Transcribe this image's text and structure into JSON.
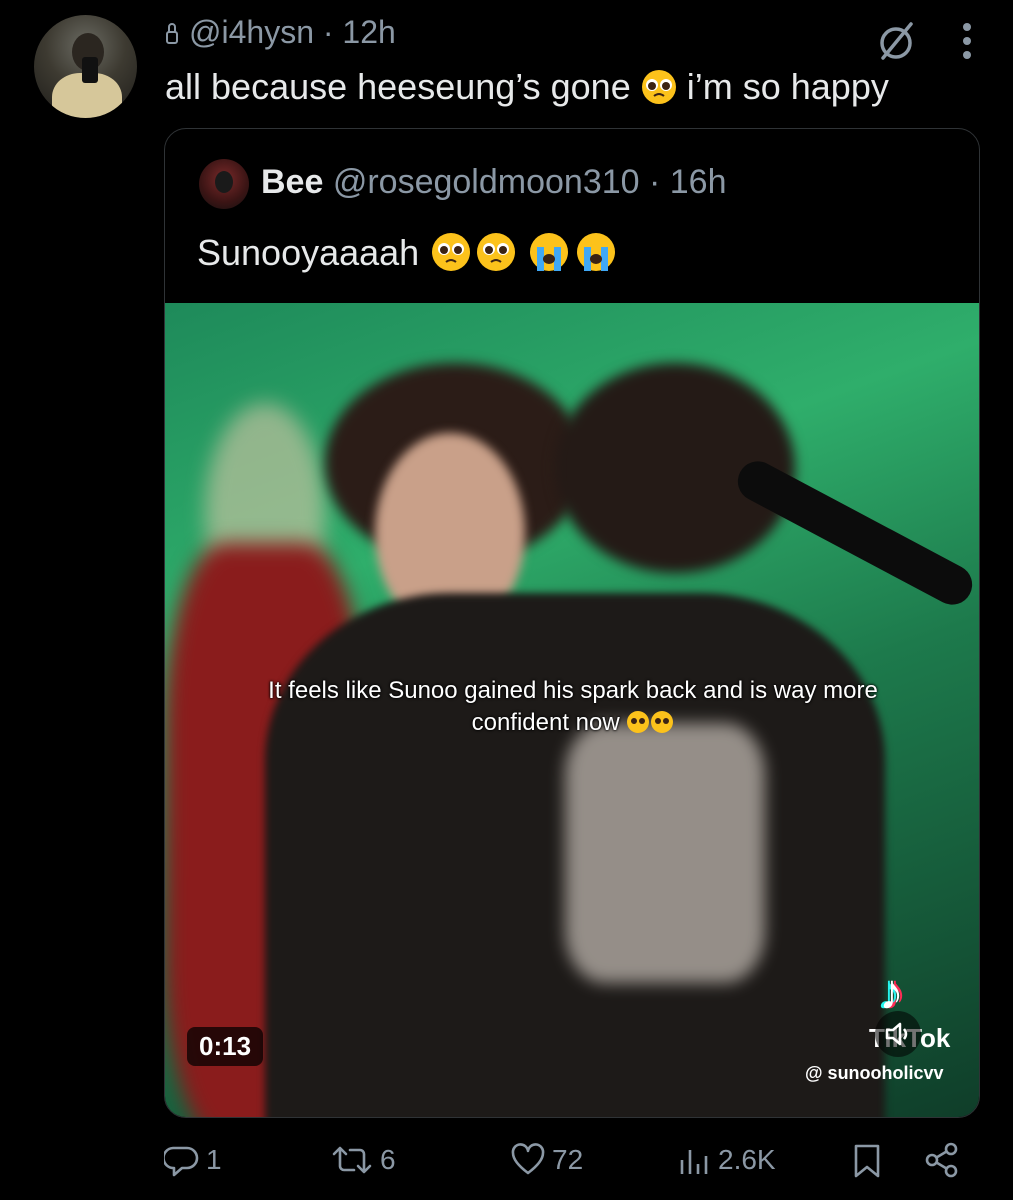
{
  "tweet": {
    "handle_meta": "@i4hysn · 12h",
    "text": "all because heeseung’s gone",
    "text_after_emoji": "i’m so happy"
  },
  "quote": {
    "name": "Bee",
    "meta": "@rosegoldmoon310 · 16h",
    "text": "Sunooyaaaah"
  },
  "media": {
    "caption_line1": "It feels like Sunoo gained his spark back and is way more",
    "caption_line2": "confident now",
    "tiktok_label": "TikTok",
    "tiktok_handle": "@ sunooholicvv",
    "duration": "0:13"
  },
  "actions": {
    "reply_count": "1",
    "repost_count": "6",
    "like_count": "72",
    "view_count": "2.6K"
  },
  "icons": [
    "lock-icon",
    "grok-icon",
    "more-icon",
    "reply-icon",
    "repost-icon",
    "like-icon",
    "views-icon",
    "bookmark-icon",
    "share-icon",
    "mute-icon",
    "tiktok-icon"
  ]
}
